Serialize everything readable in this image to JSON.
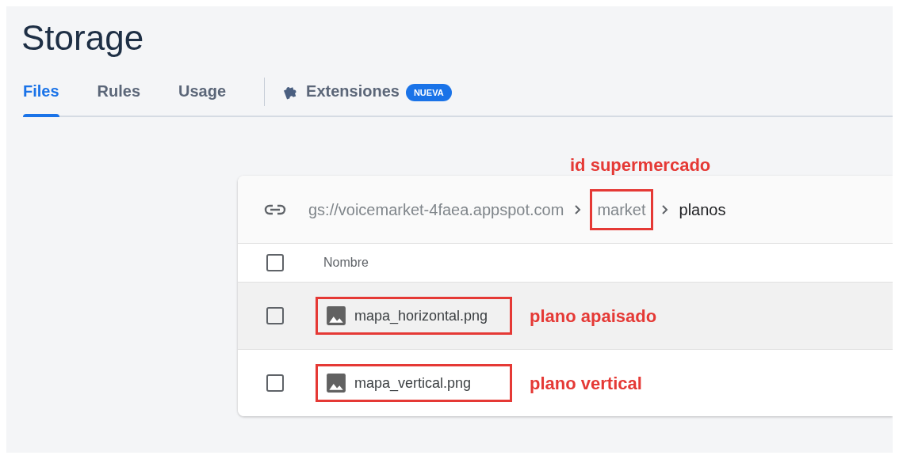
{
  "page_title": "Storage",
  "tabs": [
    {
      "label": "Files",
      "selected": true,
      "kind": "tab"
    },
    {
      "label": "Rules",
      "selected": false,
      "kind": "tab"
    },
    {
      "label": "Usage",
      "selected": false,
      "kind": "tab"
    },
    {
      "label": "Extensiones",
      "selected": false,
      "kind": "extension",
      "badge": "NUEVA"
    }
  ],
  "breadcrumb": {
    "items": [
      {
        "label": "gs://voicemarket-4faea.appspot.com",
        "current": false,
        "marked": false
      },
      {
        "label": "market",
        "current": false,
        "marked": true,
        "note": "id supermercado"
      },
      {
        "label": "planos",
        "current": true,
        "marked": false
      }
    ]
  },
  "table": {
    "columns": [
      "Nombre"
    ],
    "header_checked": false,
    "rows": [
      {
        "name": "mapa_horizontal.png",
        "checked": false,
        "hovered": true,
        "marked": true,
        "note": "plano apaisado"
      },
      {
        "name": "mapa_vertical.png",
        "checked": false,
        "hovered": false,
        "marked": true,
        "note": "plano vertical"
      }
    ]
  }
}
